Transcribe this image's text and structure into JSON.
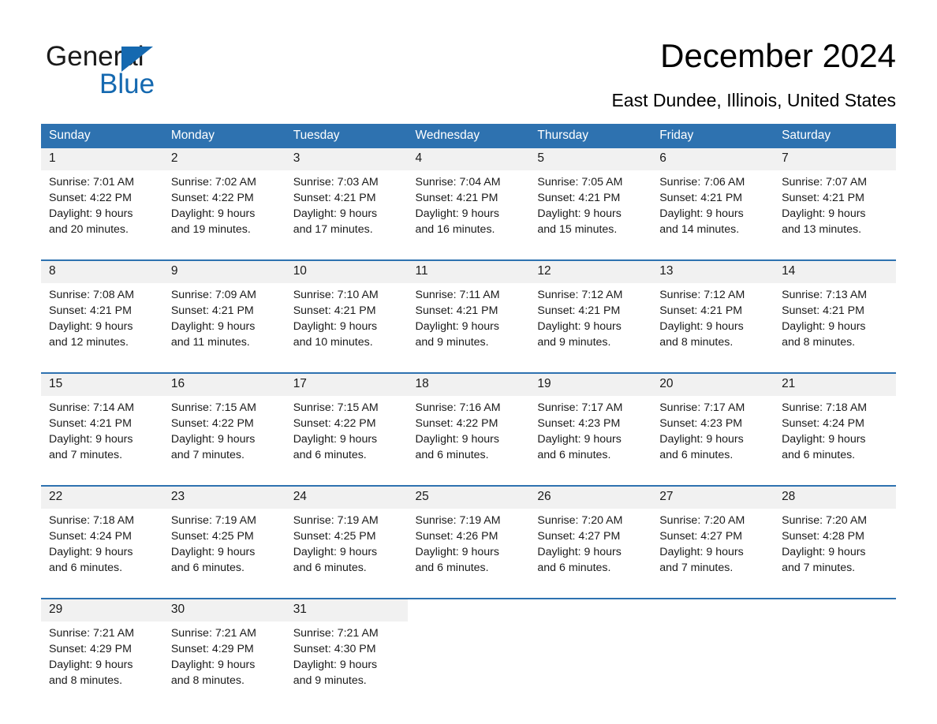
{
  "brand": {
    "name_part1": "General",
    "name_part2": "Blue",
    "accent_color": "#1569b0",
    "triangle_icon": "triangle-icon"
  },
  "header": {
    "title": "December 2024",
    "location": "East Dundee, Illinois, United States"
  },
  "calendar": {
    "header_bg": "#2e72b0",
    "date_band_bg": "#f1f1f1",
    "weekdays": [
      "Sunday",
      "Monday",
      "Tuesday",
      "Wednesday",
      "Thursday",
      "Friday",
      "Saturday"
    ],
    "weeks": [
      [
        {
          "date": "1",
          "sunrise": "Sunrise: 7:01 AM",
          "sunset": "Sunset: 4:22 PM",
          "daylight_1": "Daylight: 9 hours",
          "daylight_2": "and 20 minutes."
        },
        {
          "date": "2",
          "sunrise": "Sunrise: 7:02 AM",
          "sunset": "Sunset: 4:22 PM",
          "daylight_1": "Daylight: 9 hours",
          "daylight_2": "and 19 minutes."
        },
        {
          "date": "3",
          "sunrise": "Sunrise: 7:03 AM",
          "sunset": "Sunset: 4:21 PM",
          "daylight_1": "Daylight: 9 hours",
          "daylight_2": "and 17 minutes."
        },
        {
          "date": "4",
          "sunrise": "Sunrise: 7:04 AM",
          "sunset": "Sunset: 4:21 PM",
          "daylight_1": "Daylight: 9 hours",
          "daylight_2": "and 16 minutes."
        },
        {
          "date": "5",
          "sunrise": "Sunrise: 7:05 AM",
          "sunset": "Sunset: 4:21 PM",
          "daylight_1": "Daylight: 9 hours",
          "daylight_2": "and 15 minutes."
        },
        {
          "date": "6",
          "sunrise": "Sunrise: 7:06 AM",
          "sunset": "Sunset: 4:21 PM",
          "daylight_1": "Daylight: 9 hours",
          "daylight_2": "and 14 minutes."
        },
        {
          "date": "7",
          "sunrise": "Sunrise: 7:07 AM",
          "sunset": "Sunset: 4:21 PM",
          "daylight_1": "Daylight: 9 hours",
          "daylight_2": "and 13 minutes."
        }
      ],
      [
        {
          "date": "8",
          "sunrise": "Sunrise: 7:08 AM",
          "sunset": "Sunset: 4:21 PM",
          "daylight_1": "Daylight: 9 hours",
          "daylight_2": "and 12 minutes."
        },
        {
          "date": "9",
          "sunrise": "Sunrise: 7:09 AM",
          "sunset": "Sunset: 4:21 PM",
          "daylight_1": "Daylight: 9 hours",
          "daylight_2": "and 11 minutes."
        },
        {
          "date": "10",
          "sunrise": "Sunrise: 7:10 AM",
          "sunset": "Sunset: 4:21 PM",
          "daylight_1": "Daylight: 9 hours",
          "daylight_2": "and 10 minutes."
        },
        {
          "date": "11",
          "sunrise": "Sunrise: 7:11 AM",
          "sunset": "Sunset: 4:21 PM",
          "daylight_1": "Daylight: 9 hours",
          "daylight_2": "and 9 minutes."
        },
        {
          "date": "12",
          "sunrise": "Sunrise: 7:12 AM",
          "sunset": "Sunset: 4:21 PM",
          "daylight_1": "Daylight: 9 hours",
          "daylight_2": "and 9 minutes."
        },
        {
          "date": "13",
          "sunrise": "Sunrise: 7:12 AM",
          "sunset": "Sunset: 4:21 PM",
          "daylight_1": "Daylight: 9 hours",
          "daylight_2": "and 8 minutes."
        },
        {
          "date": "14",
          "sunrise": "Sunrise: 7:13 AM",
          "sunset": "Sunset: 4:21 PM",
          "daylight_1": "Daylight: 9 hours",
          "daylight_2": "and 8 minutes."
        }
      ],
      [
        {
          "date": "15",
          "sunrise": "Sunrise: 7:14 AM",
          "sunset": "Sunset: 4:21 PM",
          "daylight_1": "Daylight: 9 hours",
          "daylight_2": "and 7 minutes."
        },
        {
          "date": "16",
          "sunrise": "Sunrise: 7:15 AM",
          "sunset": "Sunset: 4:22 PM",
          "daylight_1": "Daylight: 9 hours",
          "daylight_2": "and 7 minutes."
        },
        {
          "date": "17",
          "sunrise": "Sunrise: 7:15 AM",
          "sunset": "Sunset: 4:22 PM",
          "daylight_1": "Daylight: 9 hours",
          "daylight_2": "and 6 minutes."
        },
        {
          "date": "18",
          "sunrise": "Sunrise: 7:16 AM",
          "sunset": "Sunset: 4:22 PM",
          "daylight_1": "Daylight: 9 hours",
          "daylight_2": "and 6 minutes."
        },
        {
          "date": "19",
          "sunrise": "Sunrise: 7:17 AM",
          "sunset": "Sunset: 4:23 PM",
          "daylight_1": "Daylight: 9 hours",
          "daylight_2": "and 6 minutes."
        },
        {
          "date": "20",
          "sunrise": "Sunrise: 7:17 AM",
          "sunset": "Sunset: 4:23 PM",
          "daylight_1": "Daylight: 9 hours",
          "daylight_2": "and 6 minutes."
        },
        {
          "date": "21",
          "sunrise": "Sunrise: 7:18 AM",
          "sunset": "Sunset: 4:24 PM",
          "daylight_1": "Daylight: 9 hours",
          "daylight_2": "and 6 minutes."
        }
      ],
      [
        {
          "date": "22",
          "sunrise": "Sunrise: 7:18 AM",
          "sunset": "Sunset: 4:24 PM",
          "daylight_1": "Daylight: 9 hours",
          "daylight_2": "and 6 minutes."
        },
        {
          "date": "23",
          "sunrise": "Sunrise: 7:19 AM",
          "sunset": "Sunset: 4:25 PM",
          "daylight_1": "Daylight: 9 hours",
          "daylight_2": "and 6 minutes."
        },
        {
          "date": "24",
          "sunrise": "Sunrise: 7:19 AM",
          "sunset": "Sunset: 4:25 PM",
          "daylight_1": "Daylight: 9 hours",
          "daylight_2": "and 6 minutes."
        },
        {
          "date": "25",
          "sunrise": "Sunrise: 7:19 AM",
          "sunset": "Sunset: 4:26 PM",
          "daylight_1": "Daylight: 9 hours",
          "daylight_2": "and 6 minutes."
        },
        {
          "date": "26",
          "sunrise": "Sunrise: 7:20 AM",
          "sunset": "Sunset: 4:27 PM",
          "daylight_1": "Daylight: 9 hours",
          "daylight_2": "and 6 minutes."
        },
        {
          "date": "27",
          "sunrise": "Sunrise: 7:20 AM",
          "sunset": "Sunset: 4:27 PM",
          "daylight_1": "Daylight: 9 hours",
          "daylight_2": "and 7 minutes."
        },
        {
          "date": "28",
          "sunrise": "Sunrise: 7:20 AM",
          "sunset": "Sunset: 4:28 PM",
          "daylight_1": "Daylight: 9 hours",
          "daylight_2": "and 7 minutes."
        }
      ],
      [
        {
          "date": "29",
          "sunrise": "Sunrise: 7:21 AM",
          "sunset": "Sunset: 4:29 PM",
          "daylight_1": "Daylight: 9 hours",
          "daylight_2": "and 8 minutes."
        },
        {
          "date": "30",
          "sunrise": "Sunrise: 7:21 AM",
          "sunset": "Sunset: 4:29 PM",
          "daylight_1": "Daylight: 9 hours",
          "daylight_2": "and 8 minutes."
        },
        {
          "date": "31",
          "sunrise": "Sunrise: 7:21 AM",
          "sunset": "Sunset: 4:30 PM",
          "daylight_1": "Daylight: 9 hours",
          "daylight_2": "and 9 minutes."
        },
        {
          "date": "",
          "sunrise": "",
          "sunset": "",
          "daylight_1": "",
          "daylight_2": ""
        },
        {
          "date": "",
          "sunrise": "",
          "sunset": "",
          "daylight_1": "",
          "daylight_2": ""
        },
        {
          "date": "",
          "sunrise": "",
          "sunset": "",
          "daylight_1": "",
          "daylight_2": ""
        },
        {
          "date": "",
          "sunrise": "",
          "sunset": "",
          "daylight_1": "",
          "daylight_2": ""
        }
      ]
    ]
  }
}
